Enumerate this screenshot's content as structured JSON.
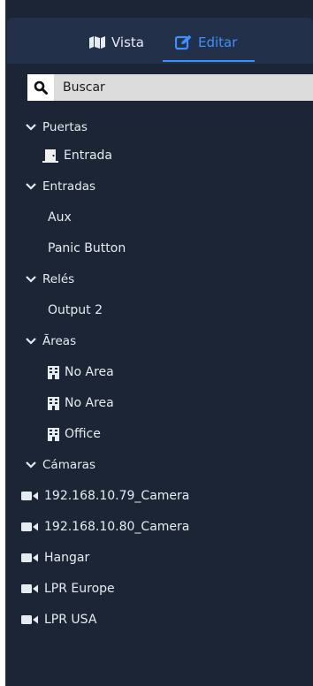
{
  "tabs": [
    {
      "label": "Vista",
      "icon": "map-icon",
      "active": false
    },
    {
      "label": "Editar",
      "icon": "edit-icon",
      "active": true
    }
  ],
  "search": {
    "placeholder": "Buscar"
  },
  "tree": {
    "groups": [
      {
        "label": "Puertas",
        "items": [
          {
            "label": "Entrada",
            "icon": "door-icon"
          }
        ]
      },
      {
        "label": "Entradas",
        "items": [
          {
            "label": "Aux"
          },
          {
            "label": "Panic Button"
          }
        ]
      },
      {
        "label": "Relés",
        "items": [
          {
            "label": "Output 2"
          }
        ]
      },
      {
        "label": "Ãreas",
        "items": [
          {
            "label": "No Area",
            "icon": "building-icon"
          },
          {
            "label": "No Area",
            "icon": "building-icon"
          },
          {
            "label": "Office",
            "icon": "building-icon"
          }
        ]
      },
      {
        "label": "Cámaras",
        "items": [
          {
            "label": "192.168.10.79_Camera",
            "icon": "camera-icon"
          },
          {
            "label": "192.168.10.80_Camera",
            "icon": "camera-icon"
          },
          {
            "label": "Hangar",
            "icon": "camera-icon"
          },
          {
            "label": "LPR Europe",
            "icon": "camera-icon"
          },
          {
            "label": "LPR USA",
            "icon": "camera-icon"
          }
        ]
      }
    ]
  },
  "colors": {
    "panel_bg": "#1c2535",
    "header_bg": "#223049",
    "accent": "#3f8fff",
    "text": "#e6ebf2"
  }
}
